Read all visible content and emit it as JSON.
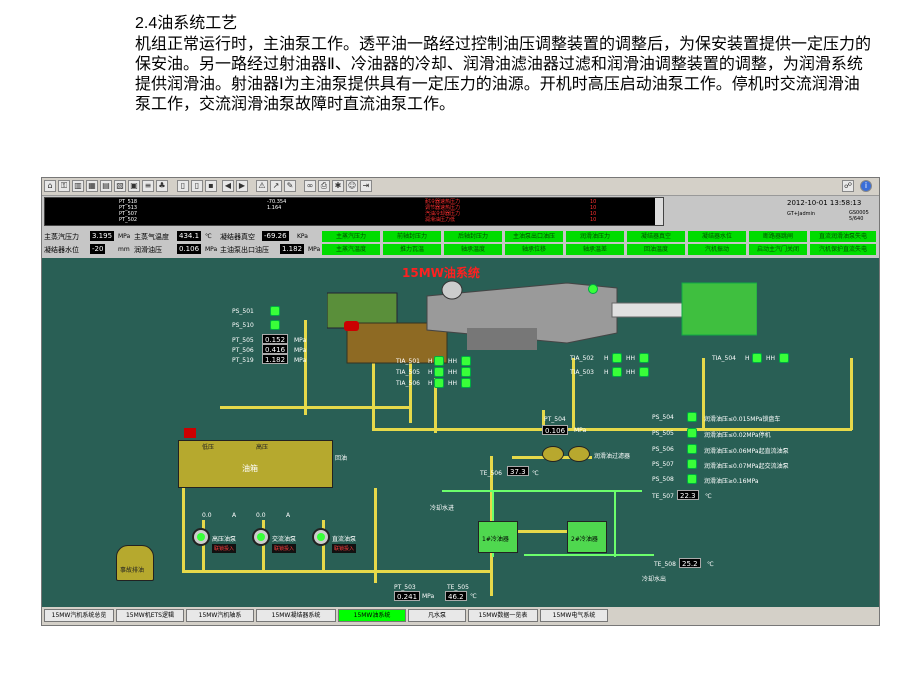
{
  "heading": {
    "title": "2.4油系统工艺",
    "body": "机组正常运行时，主油泵工作。透平油一路经过控制油压调整装置的调整后，为保安装置提供一定压力的保安油。另一路经过射油器Ⅱ、冷油器的冷却、润滑油滤油器过滤和润滑油调整装置的调整，为润滑系统提供润滑油。射油器Ⅰ为主油泵提供具有一定压力的油源。开机时高压启动油泵工作。停机时交流润滑油泵工作，交流润滑油泵故障时直流油泵工作。"
  },
  "alarm": {
    "tags": [
      "PT_518",
      "PT_513",
      "PT_507",
      "PT_502"
    ],
    "values": [
      "-70.354",
      "1.164",
      "",
      ""
    ],
    "messages": [
      "耐冷器速热压力",
      "调节器速热压力",
      "汽油冷却器压力",
      "润滑油压力低"
    ],
    "codes": [
      "10",
      "10",
      "10",
      "10"
    ]
  },
  "clock": {
    "datetime": "2012-10-01 13:58:13",
    "user": "GT+Jadmin",
    "code": "GS0005",
    "page": "5/640"
  },
  "status": {
    "row1": [
      {
        "label": "主蒸汽压力",
        "value": "3.195",
        "unit": "MPa"
      },
      {
        "label": "主蒸气温度",
        "value": "434.1",
        "unit": "℃"
      },
      {
        "label": "凝结器真空",
        "value": "-69.26",
        "unit": "KPa"
      }
    ],
    "row2": [
      {
        "label": "凝结器水位",
        "value": "-20",
        "unit": "mm"
      },
      {
        "label": "润滑油压",
        "value": "0.106",
        "unit": "MPa"
      },
      {
        "label": "主油泵出口油压",
        "value": "1.182",
        "unit": "MPa"
      }
    ],
    "buttons1": [
      "主蒸汽压力",
      "前轴封压力",
      "后轴封压力",
      "主油泵出口油压",
      "润滑油压力",
      "凝结器真空",
      "凝结器水位",
      "断路器跳闸",
      "直流润滑油泵失电"
    ],
    "buttons2": [
      "主蒸汽温度",
      "推力瓦温",
      "轴承温度",
      "轴承位移",
      "轴承温差",
      "回油温度",
      "汽机振动",
      "启动主汽门关闭",
      "汽机保护直流失电"
    ]
  },
  "canvas": {
    "title": "15MW油系统",
    "ps_left": [
      "PS_501",
      "PS_510"
    ],
    "pt_left": [
      {
        "tag": "PT_505",
        "value": "0.152",
        "unit": "MPa"
      },
      {
        "tag": "PT_506",
        "value": "0.416",
        "unit": "MPa"
      },
      {
        "tag": "PT_519",
        "value": "1.182",
        "unit": "MPa"
      }
    ],
    "tia_left": [
      "TIA_501",
      "TIA_505",
      "TIA_506"
    ],
    "tia_mid": [
      "TIA_502",
      "TIA_503"
    ],
    "tia_right": "TIA_504",
    "h": "H",
    "hh": "HH",
    "pt504": {
      "tag": "PT_504",
      "value": "0.106",
      "unit": "MPa"
    },
    "filter_label": "润滑油过滤器",
    "te506": {
      "tag": "TE_506",
      "value": "37.3",
      "unit": "℃"
    },
    "te507": {
      "tag": "TE_507",
      "value": "22.3",
      "unit": "℃"
    },
    "te508": {
      "tag": "TE_508",
      "value": "25.2",
      "unit": "℃"
    },
    "pt503": {
      "tag": "PT_503",
      "value": "0.241",
      "unit": "MPa"
    },
    "te505": {
      "tag": "TE_505",
      "value": "46.2",
      "unit": "℃"
    },
    "ps_right": [
      {
        "tag": "PS_504",
        "text": "润滑油压≤0.015MPa锁盘车"
      },
      {
        "tag": "PS_505",
        "text": "润滑油压≤0.02MPa停机"
      },
      {
        "tag": "PS_506",
        "text": "润滑油压≤0.06MPa起直流油泵"
      },
      {
        "tag": "PS_507",
        "text": "润滑油压≤0.07MPa起交流油泵"
      },
      {
        "tag": "PS_508",
        "text": "润滑油压≥0.16MPa"
      }
    ],
    "tank": {
      "name": "油箱",
      "low": "低压",
      "high": "高压",
      "return": "回油"
    },
    "emergency_tank": "事故排油",
    "cooler1": "1#冷油器",
    "cooler2": "2#冷油器",
    "cold_in": "冷却水进",
    "cold_out": "冷却水出",
    "pumps": [
      {
        "name": "高压油泵",
        "value": "0.0",
        "unit": "A",
        "tag": "联锁投入"
      },
      {
        "name": "交流油泵",
        "value": "0.0",
        "unit": "A",
        "tag": "联锁投入"
      },
      {
        "name": "直流油泵",
        "value": "",
        "unit": "",
        "tag": "联锁投入"
      }
    ]
  },
  "tabs": [
    "15MW汽机系统总览",
    "15MW机ETS逻辑",
    "15MW汽机轴系",
    "15MW凝结器系统",
    "15MW油系统",
    "凡水泵",
    "15MW数据一览表",
    "15MW电气系统"
  ],
  "active_tab": "15MW油系统"
}
